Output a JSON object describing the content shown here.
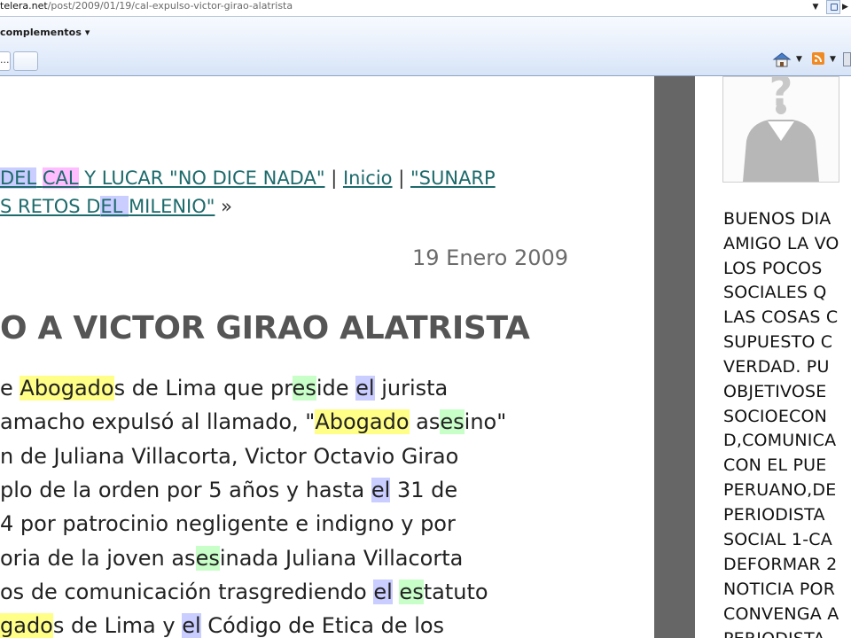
{
  "browser": {
    "address_domain": "telera.net",
    "address_path": "/post/2009/01/19/cal-expulso-victor-girao-alatrista",
    "addons_menu": "complementos ▾",
    "current_tab_label": "..."
  },
  "post": {
    "nav": {
      "prev_link": "DEL CAL Y LUCAR \"NO DICE NADA\"",
      "sep1": "|",
      "home_link": "Inicio",
      "sep2": "|",
      "next_link_line1": "\"SUNARP",
      "next_link_line2": "S RETOS DEL MILENIO\"",
      "next_arrow": "»"
    },
    "date": "19 Enero 2009",
    "title": "O A VICTOR GIRAO ALATRISTA"
  },
  "sidebar": {
    "comment_lines": [
      "BUENOS DIA",
      "AMIGO LA VO",
      "LOS POCOS",
      "SOCIALES Q",
      "LAS COSAS C",
      "SUPUESTO C",
      "VERDAD. PU",
      "OBJETIVOSE",
      "SOCIOECON",
      "D,COMUNICA",
      "CON EL PUE",
      "PERUANO,DE",
      "PERIODISTA",
      "SOCIAL 1-CA",
      "DEFORMAR 2",
      "NOTICIA POR",
      "CONVENGA A",
      "PERIODISTA"
    ]
  },
  "colors": {
    "link": "#1d6a6b",
    "highlight_yellow": "#ffff88",
    "highlight_pink": "#ffbcff",
    "highlight_blue": "#c9cdff",
    "highlight_green": "#c8ffc8",
    "gutter": "#666666"
  },
  "icons": [
    "home-icon",
    "rss-feed-icon",
    "print-icon",
    "default-avatar-icon",
    "go-icon"
  ]
}
